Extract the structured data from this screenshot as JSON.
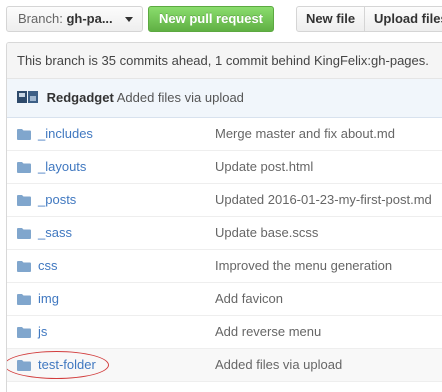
{
  "toolbar": {
    "branch_prefix": "Branch:",
    "branch_name": "gh-pa...",
    "new_pull_request": "New pull request",
    "new_file": "New file",
    "upload_files": "Upload files"
  },
  "branch_status": "This branch is 35 commits ahead, 1 commit behind KingFelix:gh-pages.",
  "latest_commit": {
    "author": "Redgadget",
    "message": "Added files via upload"
  },
  "files": [
    {
      "name": "_includes",
      "type": "folder",
      "commit": "Merge master and fix about.md"
    },
    {
      "name": "_layouts",
      "type": "folder",
      "commit": "Update post.html"
    },
    {
      "name": "_posts",
      "type": "folder",
      "commit": "Updated 2016-01-23-my-first-post.md"
    },
    {
      "name": "_sass",
      "type": "folder",
      "commit": "Update base.scss"
    },
    {
      "name": "css",
      "type": "folder",
      "commit": "Improved the menu generation"
    },
    {
      "name": "img",
      "type": "folder",
      "commit": "Add favicon"
    },
    {
      "name": "js",
      "type": "folder",
      "commit": "Add reverse menu"
    },
    {
      "name": "test-folder",
      "type": "folder",
      "commit": "Added files via upload",
      "highlighted": true
    }
  ],
  "colors": {
    "link": "#4078c0",
    "folder_icon": "#80a6cd",
    "primary_button": "#60b044",
    "highlight_ring": "#d23d3d"
  },
  "icons": [
    "caret-down-icon",
    "avatar-icon",
    "folder-icon"
  ]
}
